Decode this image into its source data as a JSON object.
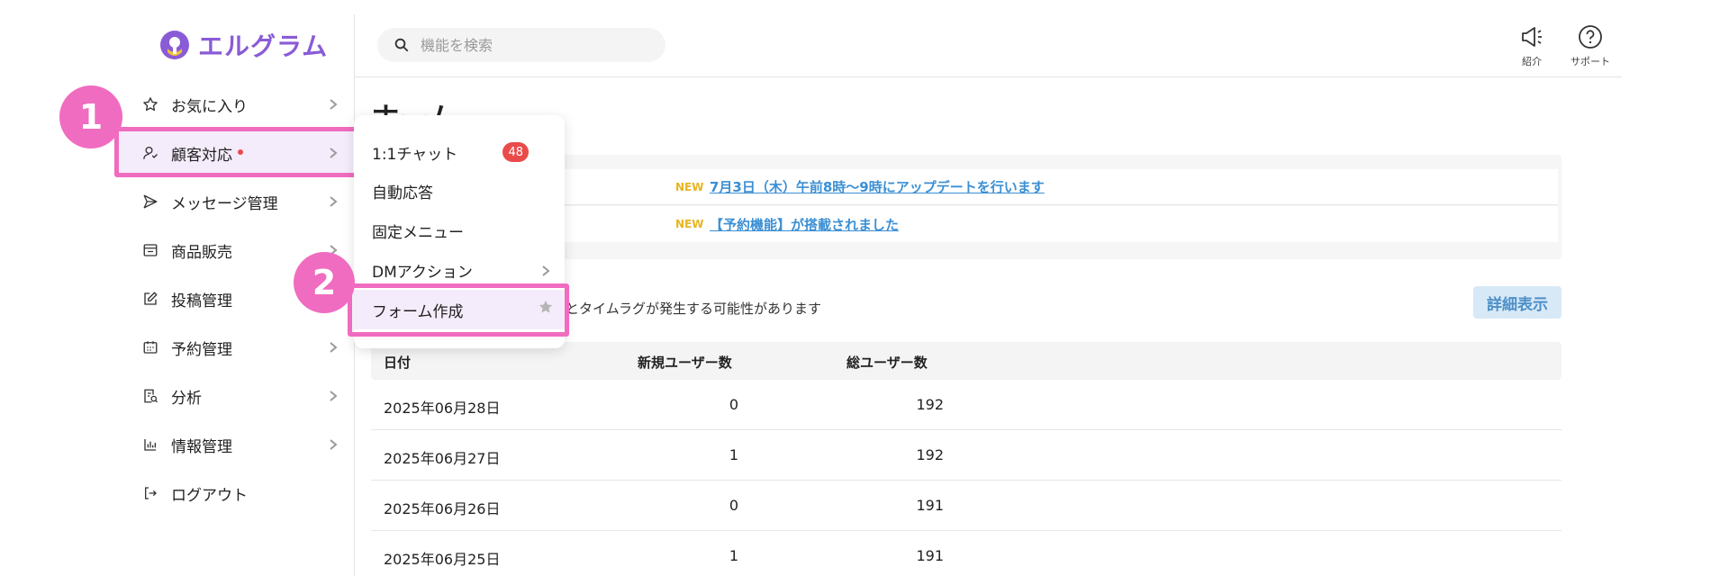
{
  "brand": {
    "name": "エルグラム",
    "color": "#8a5bd6"
  },
  "highlight_color": "#f06cc0",
  "step_badges": [
    "1",
    "2"
  ],
  "sidebar": {
    "items": [
      {
        "label": "お気に入り",
        "icon": "star-icon",
        "has_chevron": true
      },
      {
        "label": "顧客対応",
        "icon": "user-icon",
        "has_chevron": true,
        "has_dot": true,
        "active": true
      },
      {
        "label": "メッセージ管理",
        "icon": "send-icon",
        "has_chevron": true
      },
      {
        "label": "商品販売",
        "icon": "store-icon",
        "has_chevron": true
      },
      {
        "label": "投稿管理",
        "icon": "edit-icon",
        "has_chevron": true
      },
      {
        "label": "予約管理",
        "icon": "calendar-icon",
        "has_chevron": true
      },
      {
        "label": "分析",
        "icon": "report-icon",
        "has_chevron": true
      },
      {
        "label": "情報管理",
        "icon": "bar-chart-icon",
        "has_chevron": true
      },
      {
        "label": "ログアウト",
        "icon": "logout-icon",
        "has_chevron": false
      }
    ]
  },
  "search": {
    "placeholder": "機能を検索"
  },
  "header": {
    "refer_label": "紹介",
    "support_label": "サポート"
  },
  "main": {
    "title": "ホーム",
    "news": [
      {
        "tag": "NEW",
        "text": "7月3日（木）午前8時〜9時にアップデートを行います"
      },
      {
        "tag": "NEW",
        "text": "【予約機能】が搭載されました"
      }
    ],
    "note": "とタイムラグが発生する可能性があります",
    "detail_button": "詳細表示",
    "table": {
      "headers": [
        "日付",
        "新規ユーザー数",
        "総ユーザー数"
      ],
      "rows": [
        [
          "2025年06月28日",
          "0",
          "192"
        ],
        [
          "2025年06月27日",
          "1",
          "192"
        ],
        [
          "2025年06月26日",
          "0",
          "191"
        ],
        [
          "2025年06月25日",
          "1",
          "191"
        ]
      ]
    }
  },
  "submenu": {
    "items": [
      {
        "label": "1:1チャット",
        "count": "48"
      },
      {
        "label": "自動応答"
      },
      {
        "label": "固定メニュー"
      },
      {
        "label": "DMアクション",
        "has_chevron": true
      },
      {
        "label": "フォーム作成",
        "has_star": true,
        "active": true
      }
    ]
  }
}
